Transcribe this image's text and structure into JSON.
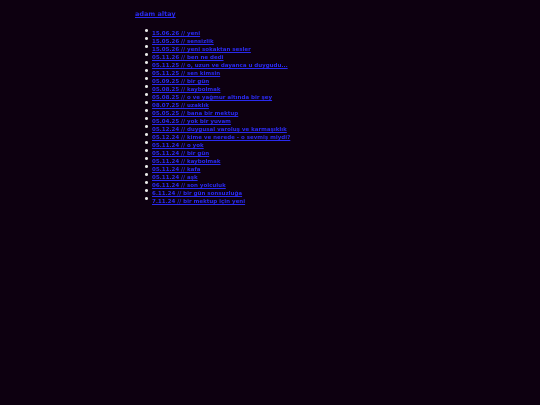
{
  "header": {
    "link_label": "adam altay"
  },
  "posts": [
    {
      "label": "15.06.26 // yeni"
    },
    {
      "label": "15.05.26 // sensizlik"
    },
    {
      "label": "15.05.26 // yeni sokaktan sesler"
    },
    {
      "label": "05.11.26 // ben ne dedi"
    },
    {
      "label": "05.11.25 // o, uzun ve dayanca u duygudu..."
    },
    {
      "label": "05.11.25 // sen kimsin"
    },
    {
      "label": "05.09.25 // bir gün"
    },
    {
      "label": "05.08.25 // kaybolmak"
    },
    {
      "label": "05.08.25 // o ve yağmur altında bir şey"
    },
    {
      "label": "08.07.25 // uzaklık"
    },
    {
      "label": "05.05.25 // bana bir mektup"
    },
    {
      "label": "05.04.25 // yok bir yuvam"
    },
    {
      "label": "05.12.24 // duygusal varoluş ve karmaşıklık"
    },
    {
      "label": "05.12.24 // kime ve nerede - o sevmiş miydi?"
    },
    {
      "label": "05.11.24 // o yok"
    },
    {
      "label": "05.11.24 // bir gün"
    },
    {
      "label": "05.11.24 // kaybolmak"
    },
    {
      "label": "05.11.24 // kafa"
    },
    {
      "label": "05.11.24 // aşk"
    },
    {
      "label": "06.11.24 // son yolculuk"
    },
    {
      "label": "6.11.24 // bir gün sonsuzluğa"
    },
    {
      "label": "7.11.24 // bir mektup için yeni"
    }
  ]
}
